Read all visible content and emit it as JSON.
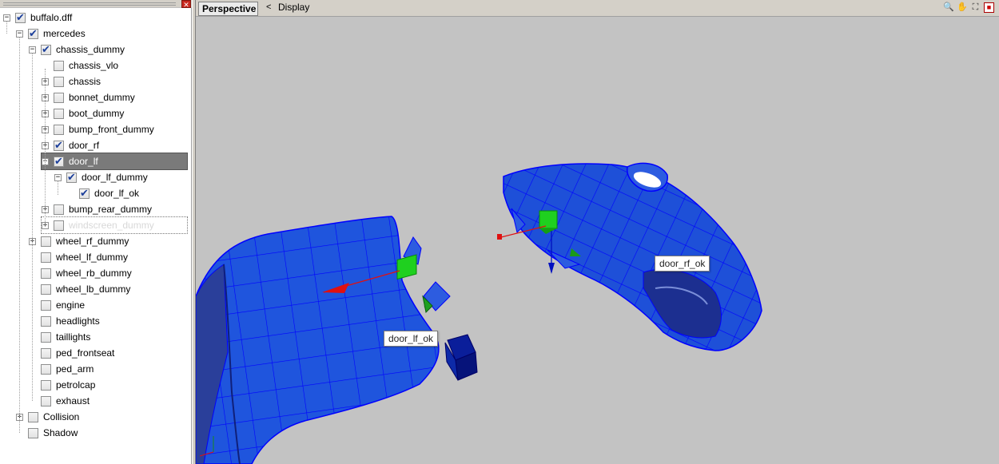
{
  "tree": {
    "nodes": [
      {
        "label": "buffalo.dff",
        "checked": true,
        "expander": "−"
      },
      {
        "label": "mercedes",
        "checked": true,
        "expander": "−"
      },
      {
        "label": "chassis_dummy",
        "checked": true,
        "expander": "−"
      },
      {
        "label": "chassis_vlo",
        "checked": false,
        "expander": ""
      },
      {
        "label": "chassis",
        "checked": false,
        "expander": "+"
      },
      {
        "label": "bonnet_dummy",
        "checked": false,
        "expander": "+"
      },
      {
        "label": "boot_dummy",
        "checked": false,
        "expander": "+"
      },
      {
        "label": "bump_front_dummy",
        "checked": false,
        "expander": "+"
      },
      {
        "label": "door_rf",
        "checked": true,
        "expander": "+"
      },
      {
        "label": "door_lf",
        "checked": true,
        "expander": "−",
        "selected": true
      },
      {
        "label": "door_lf_dummy",
        "checked": true,
        "expander": "−"
      },
      {
        "label": "door_lf_ok",
        "checked": true,
        "expander": ""
      },
      {
        "label": "bump_rear_dummy",
        "checked": false,
        "expander": "+"
      },
      {
        "label": "windscreen_dummy",
        "checked": false,
        "expander": "+",
        "focused": true
      },
      {
        "label": "wheel_rf_dummy",
        "checked": false,
        "expander": "+"
      },
      {
        "label": "wheel_lf_dummy",
        "checked": false,
        "expander": ""
      },
      {
        "label": "wheel_rb_dummy",
        "checked": false,
        "expander": ""
      },
      {
        "label": "wheel_lb_dummy",
        "checked": false,
        "expander": ""
      },
      {
        "label": "engine",
        "checked": false,
        "expander": ""
      },
      {
        "label": "headlights",
        "checked": false,
        "expander": ""
      },
      {
        "label": "taillights",
        "checked": false,
        "expander": ""
      },
      {
        "label": "ped_frontseat",
        "checked": false,
        "expander": ""
      },
      {
        "label": "ped_arm",
        "checked": false,
        "expander": ""
      },
      {
        "label": "petrolcap",
        "checked": false,
        "expander": ""
      },
      {
        "label": "exhaust",
        "checked": false,
        "expander": ""
      },
      {
        "label": "Collision",
        "checked": false,
        "expander": "+"
      },
      {
        "label": "Shadow",
        "checked": false,
        "expander": ""
      }
    ],
    "close_glyph": "✕"
  },
  "viewport": {
    "tab_label": "Perspective",
    "back_glyph": "<",
    "menu_label": "Display",
    "icons": [
      "zoom-icon",
      "hand-icon",
      "fit-icon",
      "close-view-icon"
    ],
    "labels": {
      "door_lf_ok": "door_lf_ok",
      "door_rf_ok": "door_rf_ok"
    }
  },
  "colors": {
    "mesh_fill": "#1a4fd6",
    "mesh_wire": "#0000ff",
    "gizmo_green": "#1fd01f",
    "gizmo_red": "#e01010",
    "selected_bg": "#7a7a7a",
    "background": "#c3c3c3"
  }
}
